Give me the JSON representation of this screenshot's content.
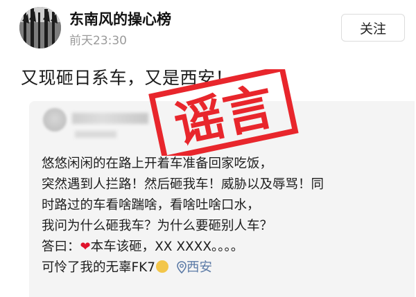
{
  "post": {
    "author": "东南风的操心榜",
    "time": "前天23:30",
    "follow_label": "关注",
    "headline": "又现砸日系车，又是西安！"
  },
  "stamp": {
    "text": "谣言",
    "color": "#e8262c"
  },
  "embedded_post": {
    "lines": [
      "悠悠闲闲的在路上开着车准备回家吃饭，",
      "突然遇到人拦路！然后砸我车！威胁以及辱骂！同",
      "时路过的车看啥踹啥，看啥吐啥口水，",
      "我问为什么砸我车？为什么要砸别人车？"
    ],
    "answer_prefix": "答曰：",
    "answer_text": "本车该砸，XX XXXX。。。。",
    "last_line": "可怜了我的无辜FK7",
    "location": "西安"
  },
  "icons": {
    "heart": "heart-emoji-icon",
    "face": "face-emoji-icon",
    "location": "location-pin-icon"
  }
}
